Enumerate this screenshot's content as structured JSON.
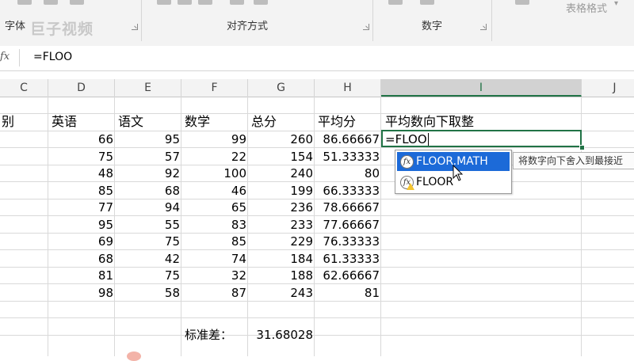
{
  "ribbon": {
    "groups": [
      {
        "label": "字体"
      },
      {
        "label": "对齐方式"
      },
      {
        "label": "数字"
      }
    ],
    "table_style_label": "表格格式",
    "watermark": "巨子视频"
  },
  "formula_bar": {
    "fx_label": "fx",
    "formula": "=FLOO"
  },
  "columns": [
    "C",
    "D",
    "E",
    "F",
    "G",
    "H",
    "I",
    "J"
  ],
  "active_column": "I",
  "header_row": {
    "C": "别",
    "D": "英语",
    "E": "语文",
    "F": "数学",
    "G": "总分",
    "H": "平均分",
    "I": "平均数向下取整"
  },
  "rows": [
    {
      "english": "66",
      "chinese": "95",
      "math": "99",
      "total": "260",
      "avg": "86.66667"
    },
    {
      "english": "75",
      "chinese": "57",
      "math": "22",
      "total": "154",
      "avg": "51.33333"
    },
    {
      "english": "48",
      "chinese": "92",
      "math": "100",
      "total": "240",
      "avg": "80"
    },
    {
      "english": "85",
      "chinese": "68",
      "math": "46",
      "total": "199",
      "avg": "66.33333"
    },
    {
      "english": "77",
      "chinese": "94",
      "math": "65",
      "total": "236",
      "avg": "78.66667"
    },
    {
      "english": "95",
      "chinese": "55",
      "math": "83",
      "total": "233",
      "avg": "77.66667"
    },
    {
      "english": "69",
      "chinese": "75",
      "math": "85",
      "total": "229",
      "avg": "76.33333"
    },
    {
      "english": "68",
      "chinese": "42",
      "math": "74",
      "total": "184",
      "avg": "61.33333"
    },
    {
      "english": "81",
      "chinese": "75",
      "math": "32",
      "total": "188",
      "avg": "62.66667"
    },
    {
      "english": "98",
      "chinese": "58",
      "math": "87",
      "total": "243",
      "avg": "81"
    }
  ],
  "std_dev": {
    "label": "标准差：",
    "value": "31.68028"
  },
  "active_cell": {
    "text": "=FLOO"
  },
  "autocomplete": {
    "items": [
      {
        "name": "FLOOR.MATH",
        "selected": true
      },
      {
        "name": "FLOOR",
        "selected": false
      }
    ],
    "tooltip": "将数字向下舍入到最接近"
  },
  "colors": {
    "accent": "#217346",
    "selection": "#1c6ad8"
  }
}
